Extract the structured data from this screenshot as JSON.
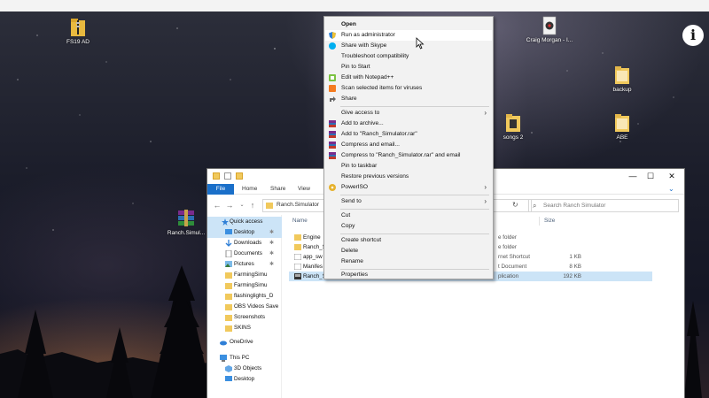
{
  "desktop": {
    "icons": [
      {
        "name": "fs19-ad-folder",
        "label": "FS19 AD"
      },
      {
        "name": "craig-morgan-file",
        "label": "Craig Morgan - I..."
      },
      {
        "name": "backup-folder",
        "label": "backup"
      },
      {
        "name": "songs-2-folder",
        "label": "songs 2"
      },
      {
        "name": "abe-folder",
        "label": "ABE"
      },
      {
        "name": "ranch-simulator-archive",
        "label": "Ranch.Simul..."
      }
    ],
    "info_glyph": "i"
  },
  "context_menu": {
    "items": [
      {
        "label": "Open",
        "bold": true
      },
      {
        "label": "Run as administrator",
        "icon": "shield-icon",
        "hover": true
      },
      {
        "label": "Share with Skype",
        "icon": "skype-icon"
      },
      {
        "label": "Troubleshoot compatibility"
      },
      {
        "label": "Pin to Start"
      },
      {
        "label": "Edit with Notepad++",
        "icon": "notepad-plus-icon"
      },
      {
        "label": "Scan selected items for viruses",
        "icon": "antivirus-icon"
      },
      {
        "label": "Share",
        "icon": "share-icon"
      },
      {
        "label": "Give access to",
        "submenu": true
      },
      {
        "label": "Add to archive...",
        "icon": "winrar-icon"
      },
      {
        "label": "Add to \"Ranch_Simulator.rar\"",
        "icon": "winrar-icon"
      },
      {
        "label": "Compress and email...",
        "icon": "winrar-icon"
      },
      {
        "label": "Compress to \"Ranch_Simulator.rar\" and email",
        "icon": "winrar-icon"
      },
      {
        "label": "Pin to taskbar"
      },
      {
        "label": "Restore previous versions"
      },
      {
        "label": "PowerISO",
        "icon": "poweriso-icon",
        "submenu": true
      },
      {
        "label": "Send to",
        "submenu": true
      },
      {
        "label": "Cut"
      },
      {
        "label": "Copy"
      },
      {
        "label": "Create shortcut"
      },
      {
        "label": "Delete"
      },
      {
        "label": "Rename"
      },
      {
        "label": "Properties"
      }
    ]
  },
  "explorer": {
    "ribbon_tabs": [
      "File",
      "Home",
      "Share",
      "View"
    ],
    "address": "Ranch.Simulator",
    "search_placeholder": "Search Ranch Simulator",
    "columns": {
      "name": "Name",
      "size": "Size"
    },
    "window_controls": {
      "minimize": "—",
      "maximize": "☐",
      "close": "✕"
    },
    "nav": [
      {
        "label": "Quick access",
        "icon": "star-icon",
        "selected": true
      },
      {
        "label": "Desktop",
        "icon": "desktop-icon",
        "pin": true,
        "selected": true
      },
      {
        "label": "Downloads",
        "icon": "download-icon",
        "pin": true
      },
      {
        "label": "Documents",
        "icon": "documents-icon",
        "pin": true
      },
      {
        "label": "Pictures",
        "icon": "pictures-icon",
        "pin": true
      },
      {
        "label": "FarmingSimu",
        "icon": "folder-icon"
      },
      {
        "label": "FarmingSimu",
        "icon": "folder-icon"
      },
      {
        "label": "flashinglights_D",
        "icon": "folder-icon"
      },
      {
        "label": "OBS Videos Save",
        "icon": "folder-icon"
      },
      {
        "label": "Screenshots",
        "icon": "folder-icon"
      },
      {
        "label": "SKINS",
        "icon": "folder-icon"
      },
      {
        "label": "OneDrive",
        "icon": "cloud-icon"
      },
      {
        "label": "This PC",
        "icon": "pc-icon"
      },
      {
        "label": "3D Objects",
        "icon": "cube-icon"
      },
      {
        "label": "Desktop",
        "icon": "desktop-icon"
      }
    ],
    "files": [
      {
        "name": "Engine",
        "type": "e folder",
        "size": ""
      },
      {
        "name": "Ranch_S",
        "type": "e folder",
        "size": ""
      },
      {
        "name": "app_sw",
        "type": "rnet Shortcut",
        "size": "1 KB"
      },
      {
        "name": "Manifes",
        "type": "t Document",
        "size": "8 KB"
      },
      {
        "name": "Ranch_S",
        "type": "plication",
        "size": "192 KB",
        "selected": true
      }
    ]
  }
}
